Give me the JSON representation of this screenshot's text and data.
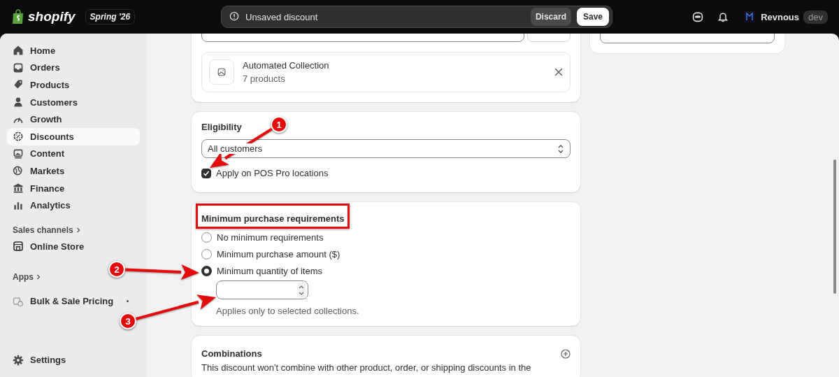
{
  "topbar": {
    "logo": "shopify",
    "edition": "Spring '26",
    "notice": "Unsaved discount",
    "discard": "Discard",
    "save": "Save",
    "store": "Revnous",
    "store_tag": "dev"
  },
  "sidebar": {
    "items": [
      {
        "label": "Home",
        "selected": false
      },
      {
        "label": "Orders",
        "selected": false
      },
      {
        "label": "Products",
        "selected": false
      },
      {
        "label": "Customers",
        "selected": false
      },
      {
        "label": "Growth",
        "selected": false
      },
      {
        "label": "Discounts",
        "selected": true
      },
      {
        "label": "Content",
        "selected": false
      },
      {
        "label": "Markets",
        "selected": false
      },
      {
        "label": "Finance",
        "selected": false
      },
      {
        "label": "Analytics",
        "selected": false
      }
    ],
    "sales_channels": {
      "heading": "Sales channels",
      "items": [
        {
          "label": "Online Store"
        }
      ]
    },
    "apps": {
      "heading": "Apps",
      "items": [
        {
          "label": "Bulk & Sale Pricing",
          "indicator": true
        }
      ]
    },
    "settings": "Settings"
  },
  "collection": {
    "title": "Automated Collection",
    "count": "7 products"
  },
  "eligibility": {
    "title": "Eligibility",
    "select": "All customers",
    "pos_checkbox": {
      "label": "Apply on POS Pro locations",
      "checked": true
    }
  },
  "minimum": {
    "title": "Minimum purchase requirements",
    "options": [
      {
        "label": "No minimum requirements",
        "selected": false
      },
      {
        "label": "Minimum purchase amount ($)",
        "selected": false
      },
      {
        "label": "Minimum quantity of items",
        "selected": true
      }
    ],
    "help": "Applies only to selected collections."
  },
  "combinations": {
    "title": "Combinations",
    "text": "This discount won't combine with other product, order, or shipping discounts in the"
  },
  "annotations": [
    {
      "number": "1"
    },
    {
      "number": "2"
    },
    {
      "number": "3"
    }
  ]
}
